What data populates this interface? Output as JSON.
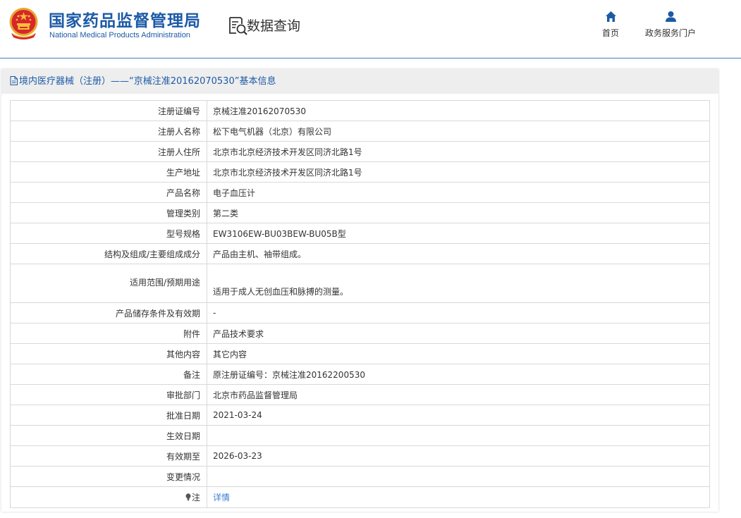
{
  "header": {
    "org_name_cn": "国家药品监督管理局",
    "org_name_en": "National Medical Products Administration",
    "page_title": "数据查询",
    "emblem_icon": "national-emblem-icon",
    "query_icon": "document-search-icon"
  },
  "nav": {
    "home_label": "首页",
    "home_icon": "home-icon",
    "portal_label": "政务服务门户",
    "portal_icon": "user-icon"
  },
  "panel": {
    "title": "境内医疗器械（注册）——“京械注准20162070530”基本信息",
    "title_icon": "document-icon"
  },
  "rows": [
    {
      "label": "注册证编号",
      "value": "京械注准20162070530"
    },
    {
      "label": "注册人名称",
      "value": "松下电气机器（北京）有限公司"
    },
    {
      "label": "注册人住所",
      "value": "北京市北京经济技术开发区同济北路1号"
    },
    {
      "label": "生产地址",
      "value": "北京市北京经济技术开发区同济北路1号"
    },
    {
      "label": "产品名称",
      "value": "电子血压计"
    },
    {
      "label": "管理类别",
      "value": "第二类"
    },
    {
      "label": "型号规格",
      "value": "EW3106EW-BU03BEW-BU05B型"
    },
    {
      "label": "结构及组成/主要组成成分",
      "value": "产品由主机、袖带组成。"
    },
    {
      "label": "适用范围/预期用途",
      "value": "适用于成人无创血压和脉搏的测量。"
    },
    {
      "label": "产品储存条件及有效期",
      "value": "-"
    },
    {
      "label": "附件",
      "value": "产品技术要求"
    },
    {
      "label": "其他内容",
      "value": "其它内容"
    },
    {
      "label": "备注",
      "value": "原注册证编号：京械注准20162200530"
    },
    {
      "label": "审批部门",
      "value": "北京市药品监督管理局"
    },
    {
      "label": "批准日期",
      "value": "2021-03-24"
    },
    {
      "label": "生效日期",
      "value": ""
    },
    {
      "label": "有效期至",
      "value": "2026-03-23"
    },
    {
      "label": "变更情况",
      "value": ""
    },
    {
      "label": "注",
      "value": "详情",
      "icon": "lightbulb-icon"
    }
  ],
  "colors": {
    "brand_blue": "#1c5aa6",
    "link_blue": "#3a7ed0",
    "emblem_red": "#d8262b",
    "emblem_gold": "#f2c037"
  }
}
